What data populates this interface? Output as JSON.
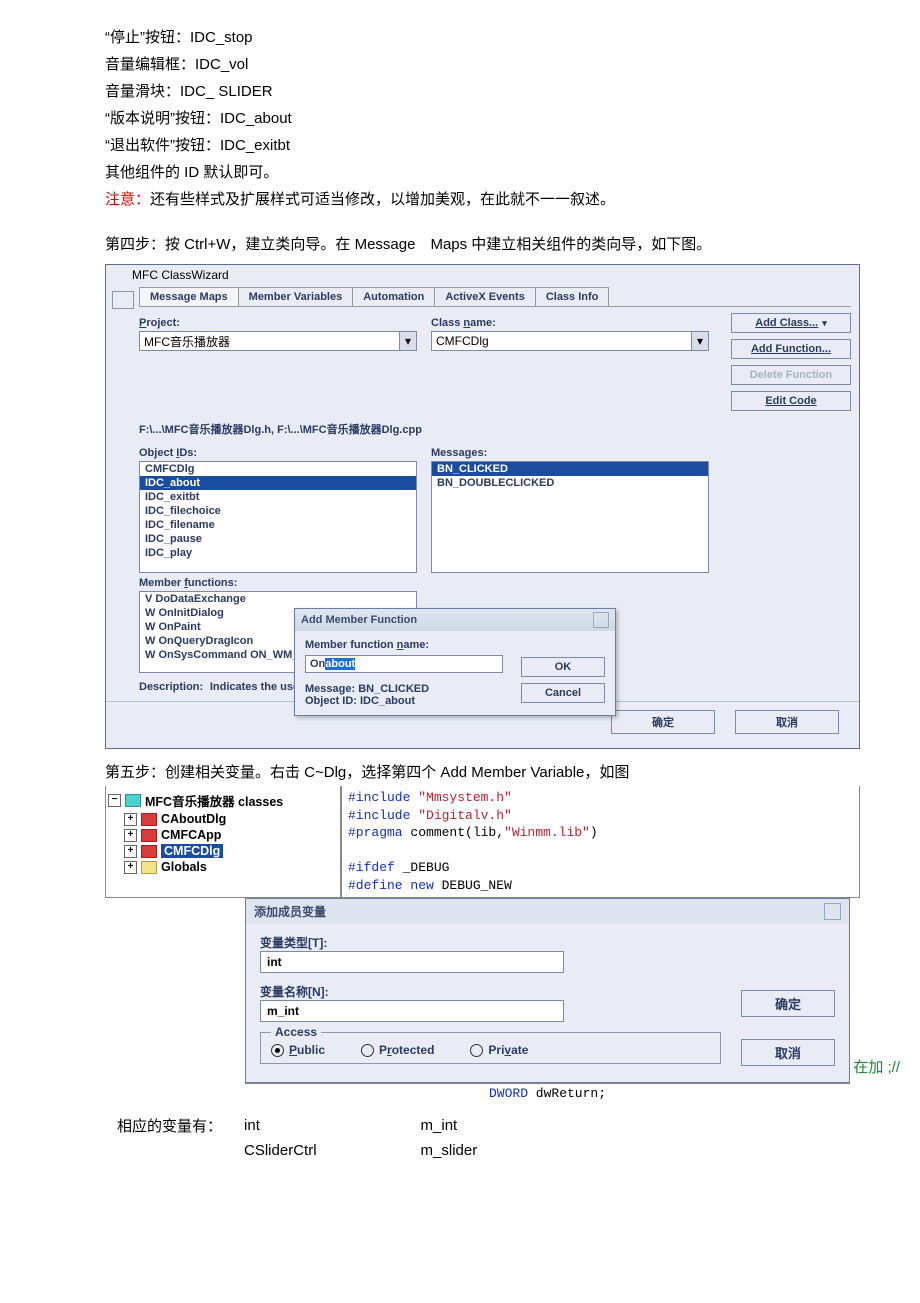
{
  "text": {
    "l1": "“停止”按钮：IDC_stop",
    "l2": "音量编辑框：IDC_vol",
    "l3": "音量滑块：IDC_ SLIDER",
    "l4": "“版本说明”按钮：IDC_about",
    "l5": "“退出软件”按钮：IDC_exitbt",
    "l6": "其他组件的 ID 默认即可。",
    "note_pre": "注意：",
    "note": "还有些样式及扩展样式可适当修改，以增加美观，在此就不一一叙述。",
    "step4": "第四步：按 Ctrl+W，建立类向导。在 Message Maps 中建立相关组件的类向导，如下图。",
    "step5": "第五步：创建相关变量。右击 C~Dlg，选择第四个 Add Member Variable，如图",
    "vars_intro": "相应的变量有：",
    "var1_t": "int",
    "var1_n": "m_int",
    "var2_t": "CSliderCtrl",
    "var2_n": "m_slider"
  },
  "cw": {
    "title": "MFC ClassWizard",
    "tabs": [
      "Message Maps",
      "Member Variables",
      "Automation",
      "ActiveX Events",
      "Class Info"
    ],
    "project_lbl": "Project:",
    "project_val": "MFC音乐播放器",
    "class_lbl": "Class name:",
    "class_val": "CMFCDlg",
    "path": "F:\\...\\MFC音乐播放器Dlg.h, F:\\...\\MFC音乐播放器Dlg.cpp",
    "objids_lbl": "Object IDs:",
    "objects": [
      "CMFCDlg",
      "IDC_about",
      "IDC_exitbt",
      "IDC_filechoice",
      "IDC_filename",
      "IDC_pause",
      "IDC_play"
    ],
    "msgs_lbl": "Messages:",
    "messages": [
      "BN_CLICKED",
      "BN_DOUBLECLICKED"
    ],
    "memfn_lbl": "Member functions:",
    "memfns": [
      "V  DoDataExchange",
      "W  OnInitDialog",
      "W  OnPaint",
      "W  OnQueryDragIcon",
      "W  OnSysCommand    ON_WM_SYSCOMMAND"
    ],
    "desc_lbl": "Description:",
    "desc_val": "Indicates the user clicked a button",
    "btns": {
      "add_class": "Add Class...",
      "add_fn": "Add Function...",
      "del_fn": "Delete Function",
      "edit_code": "Edit Code"
    },
    "ok": "确定",
    "cancel": "取消",
    "amf": {
      "title": "Add Member Function",
      "name_lbl": "Member function name:",
      "name_val_pre": "On",
      "name_val_sel": "about",
      "msg": "Message: BN_CLICKED",
      "obj": "Object ID: IDC_about",
      "ok": "OK",
      "cancel": "Cancel"
    }
  },
  "tree": {
    "root": "MFC音乐播放器 classes",
    "nodes": [
      "CAboutDlg",
      "CMFCApp",
      "CMFCDlg",
      "Globals"
    ]
  },
  "code": {
    "l1a": "#include ",
    "l1b": "\"Mmsystem.h\"",
    "l2a": "#include ",
    "l2b": "\"Digitalv.h\"",
    "l3a": "#pragma",
    "l3b": " comment(lib,",
    "l3c": "\"Winmm.lib\"",
    "l3d": ")",
    "l4a": "#ifdef",
    "l4b": " _DEBUG",
    "l5a": "#define new",
    "l5b": " DEBUG_NEW",
    "ret_t": "DWORD",
    "ret_n": " dwReturn;",
    "side": "在加\n;//"
  },
  "amv": {
    "title": "添加成员变量",
    "type_lbl": "变量类型[T]:",
    "type_val": "int",
    "name_lbl": "变量名称[N]:",
    "name_val": "m_int",
    "access": "Access",
    "pub": "Public",
    "prot": "Protected",
    "priv": "Private",
    "ok": "确定",
    "cancel": "取消"
  }
}
